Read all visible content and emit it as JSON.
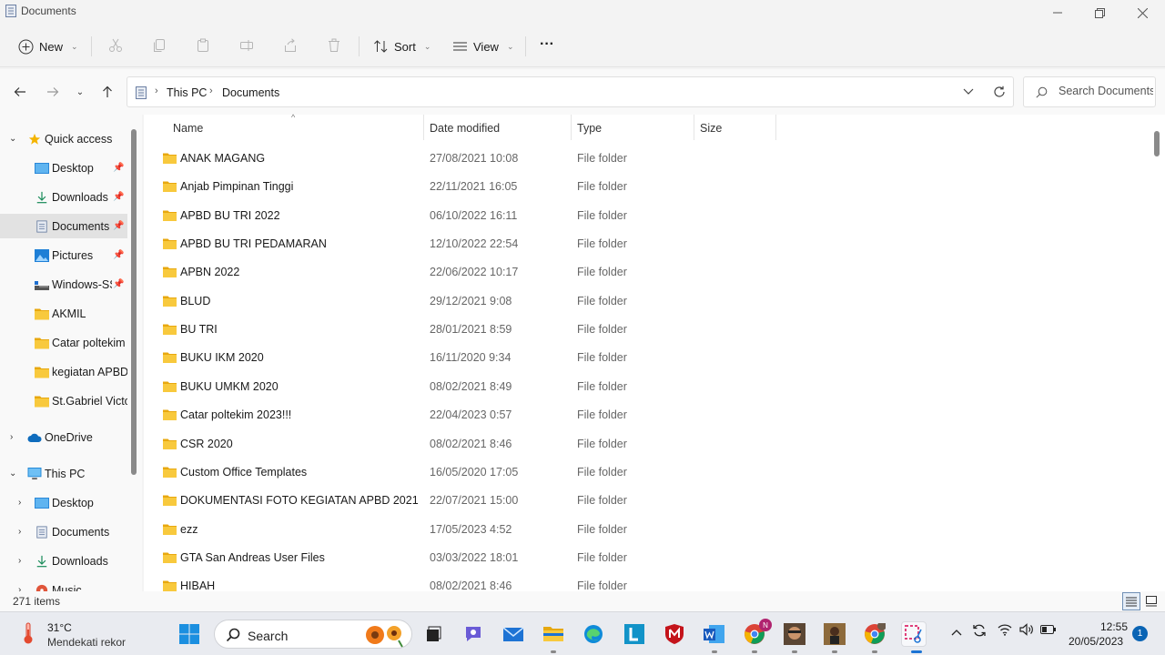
{
  "window": {
    "title": "Documents"
  },
  "toolbar": {
    "new_label": "New",
    "sort_label": "Sort",
    "view_label": "View",
    "more_label": "···"
  },
  "address": {
    "crumbs": [
      "This PC",
      "Documents"
    ]
  },
  "search": {
    "placeholder": "Search Documents"
  },
  "sidebar": {
    "quick_access": "Quick access",
    "items": [
      {
        "label": "Desktop",
        "pinned": true
      },
      {
        "label": "Downloads",
        "pinned": true
      },
      {
        "label": "Documents",
        "pinned": true
      },
      {
        "label": "Pictures",
        "pinned": true
      },
      {
        "label": "Windows-SS",
        "pinned": true
      },
      {
        "label": "AKMIL",
        "pinned": false
      },
      {
        "label": "Catar poltekim",
        "pinned": false
      },
      {
        "label": "kegiatan APBD",
        "pinned": false
      },
      {
        "label": "St.Gabriel Victor",
        "pinned": false
      }
    ],
    "onedrive": "OneDrive",
    "this_pc": "This PC",
    "pc_items": [
      "Desktop",
      "Documents",
      "Downloads",
      "Music"
    ]
  },
  "columns": {
    "name": "Name",
    "date": "Date modified",
    "type": "Type",
    "size": "Size"
  },
  "files": [
    {
      "name": "ANAK MAGANG",
      "date": "27/08/2021 10:08",
      "type": "File folder"
    },
    {
      "name": "Anjab Pimpinan Tinggi",
      "date": "22/11/2021 16:05",
      "type": "File folder"
    },
    {
      "name": "APBD BU TRI 2022",
      "date": "06/10/2022 16:11",
      "type": "File folder"
    },
    {
      "name": "APBD BU TRI PEDAMARAN",
      "date": "12/10/2022 22:54",
      "type": "File folder"
    },
    {
      "name": "APBN 2022",
      "date": "22/06/2022 10:17",
      "type": "File folder"
    },
    {
      "name": "BLUD",
      "date": "29/12/2021 9:08",
      "type": "File folder"
    },
    {
      "name": "BU TRI",
      "date": "28/01/2021 8:59",
      "type": "File folder"
    },
    {
      "name": "BUKU IKM 2020",
      "date": "16/11/2020 9:34",
      "type": "File folder"
    },
    {
      "name": "BUKU UMKM 2020",
      "date": "08/02/2021 8:49",
      "type": "File folder"
    },
    {
      "name": "Catar poltekim 2023!!!",
      "date": "22/04/2023 0:57",
      "type": "File folder"
    },
    {
      "name": "CSR 2020",
      "date": "08/02/2021 8:46",
      "type": "File folder"
    },
    {
      "name": "Custom Office Templates",
      "date": "16/05/2020 17:05",
      "type": "File folder"
    },
    {
      "name": "DOKUMENTASI FOTO KEGIATAN APBD 2021",
      "date": "22/07/2021 15:00",
      "type": "File folder"
    },
    {
      "name": "ezz",
      "date": "17/05/2023 4:52",
      "type": "File folder"
    },
    {
      "name": "GTA San Andreas User Files",
      "date": "03/03/2022 18:01",
      "type": "File folder"
    },
    {
      "name": "HIBAH",
      "date": "08/02/2021 8:46",
      "type": "File folder"
    }
  ],
  "status": {
    "count": "271 items"
  },
  "taskbar": {
    "weather_temp": "31°C",
    "weather_desc": "Mendekati rekor",
    "search_label": "Search",
    "time": "12:55",
    "date": "20/05/2023",
    "notifications": "1",
    "chrome_badge": "N"
  },
  "colors": {
    "folder": "#f4c53d",
    "accent": "#0a64b4",
    "selected": "#e2e2e2"
  }
}
